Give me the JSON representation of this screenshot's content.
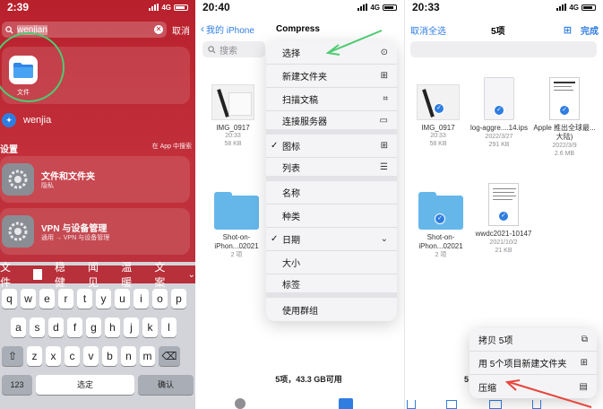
{
  "panel1": {
    "status": {
      "time": "2:39",
      "network": "4G"
    },
    "search": {
      "query": "wenjian",
      "cancel": "取消"
    },
    "top_hit": {
      "label": "文件"
    },
    "suggestion": {
      "text": "wenjia"
    },
    "section": {
      "title": "设置",
      "link": "在 App 中搜索"
    },
    "results": [
      {
        "title": "文件和文件夹",
        "subtitle": "隐私"
      },
      {
        "title": "VPN 与设备管理",
        "subtitle": "通用 → VPN 与设备管理"
      }
    ],
    "keyboard": {
      "suggestions": [
        "文件",
        "稳健",
        "闻见",
        "温暖",
        "文案"
      ],
      "row1": [
        "q",
        "w",
        "e",
        "r",
        "t",
        "y",
        "u",
        "i",
        "o",
        "p"
      ],
      "row2": [
        "a",
        "s",
        "d",
        "f",
        "g",
        "h",
        "j",
        "k",
        "l"
      ],
      "row3": [
        "z",
        "x",
        "c",
        "v",
        "b",
        "n",
        "m"
      ],
      "numbers": "123",
      "select": "选定",
      "confirm": "确认"
    }
  },
  "panel2": {
    "status": {
      "time": "20:40",
      "network": "4G"
    },
    "back_label": "我的 iPhone",
    "title": "Compress",
    "search_placeholder": "搜索",
    "files": [
      {
        "name": "IMG_0917",
        "time": "20:33",
        "size": "58 KB"
      },
      {
        "name": "Shot-on-iPhon...02021",
        "size": "2 项"
      }
    ],
    "menu": [
      {
        "label": "选择"
      },
      {
        "label": "新建文件夹"
      },
      {
        "label": "扫描文稿"
      },
      {
        "label": "连接服务器"
      },
      {
        "label": "图标",
        "checked": "✓"
      },
      {
        "label": "列表"
      },
      {
        "label": "名称"
      },
      {
        "label": "种类"
      },
      {
        "label": "日期",
        "checked": "✓"
      },
      {
        "label": "大小"
      },
      {
        "label": "标签"
      },
      {
        "label": "使用群组"
      }
    ],
    "footer": "5项，43.3 GB可用"
  },
  "panel3": {
    "status": {
      "time": "20:33",
      "network": "4G"
    },
    "deselect_all": "取消全选",
    "title": "5项",
    "done": "完成",
    "files": [
      {
        "name": "IMG_0917",
        "time": "20:33",
        "size": "58 KB"
      },
      {
        "name": "log-aggre....14.ips",
        "date": "2022/3/27",
        "size": "291 KB"
      },
      {
        "name": "Apple 推出全球最...大陆)",
        "date": "2022/3/9",
        "size": "2.6 MB"
      },
      {
        "name": "Shot-on-iPhon...02021",
        "size": "2 项"
      },
      {
        "name": "wwdc2021-10147",
        "date": "2021/10/2",
        "size": "21 KB"
      }
    ],
    "context_menu": [
      {
        "label": "拷贝 5项"
      },
      {
        "label": "用 5个项目新建文件夹"
      },
      {
        "label": "压缩"
      }
    ]
  }
}
